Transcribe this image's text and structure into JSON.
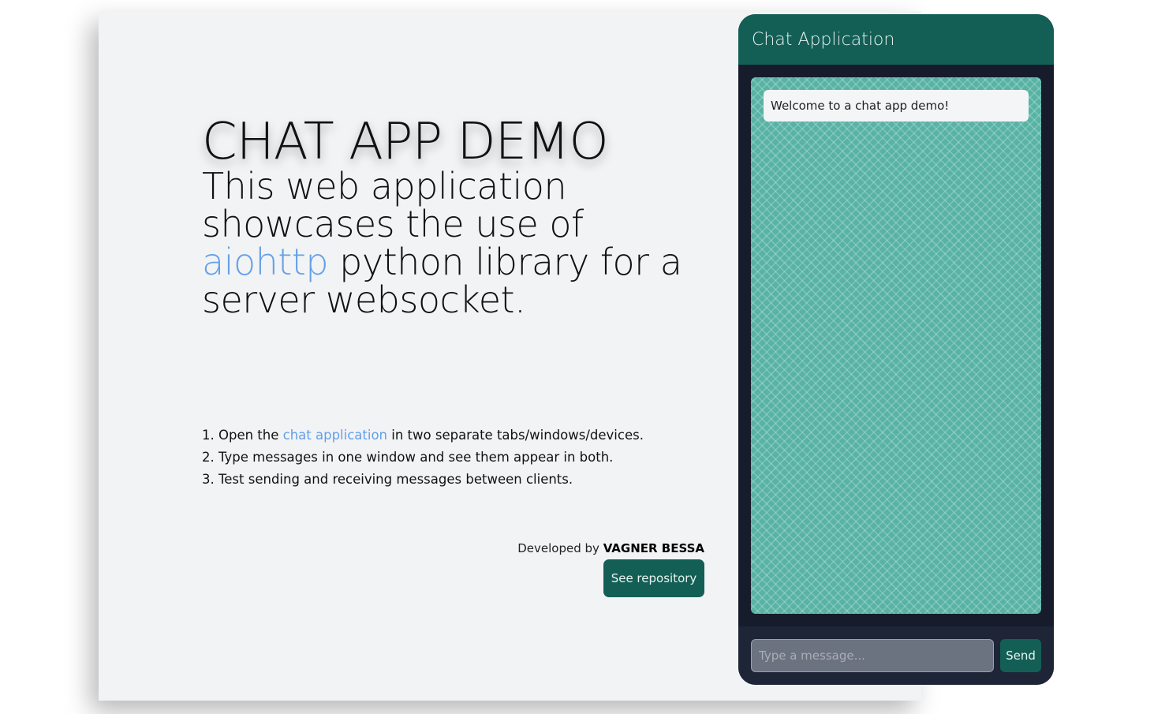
{
  "hero": {
    "title": "CHAT APP DEMO",
    "subtitle_pre": "This web application showcases the use of ",
    "subtitle_link": "aiohttp",
    "subtitle_post": " python library for a server websocket."
  },
  "steps": [
    {
      "number": "1.",
      "pre": " Open the ",
      "link": "chat application",
      "post": " in two separate tabs/windows/devices."
    },
    {
      "number": "2.",
      "text": " Type messages in one window and see them appear in both."
    },
    {
      "number": "3.",
      "text": " Test sending and receiving messages between clients."
    }
  ],
  "credits": {
    "prefix": "Developed by ",
    "author": "VAGNER BESSA",
    "repo_button": "See repository"
  },
  "chat": {
    "title": "Chat Application",
    "messages": [
      {
        "text": "Welcome to a chat app demo!"
      }
    ],
    "input_placeholder": "Type a message...",
    "input_value": "",
    "send_label": "Send"
  },
  "colors": {
    "accent": "#135f56",
    "link": "#63a0e8",
    "chat_background": "#59b3a5",
    "panel_dark": "#161c2b"
  }
}
